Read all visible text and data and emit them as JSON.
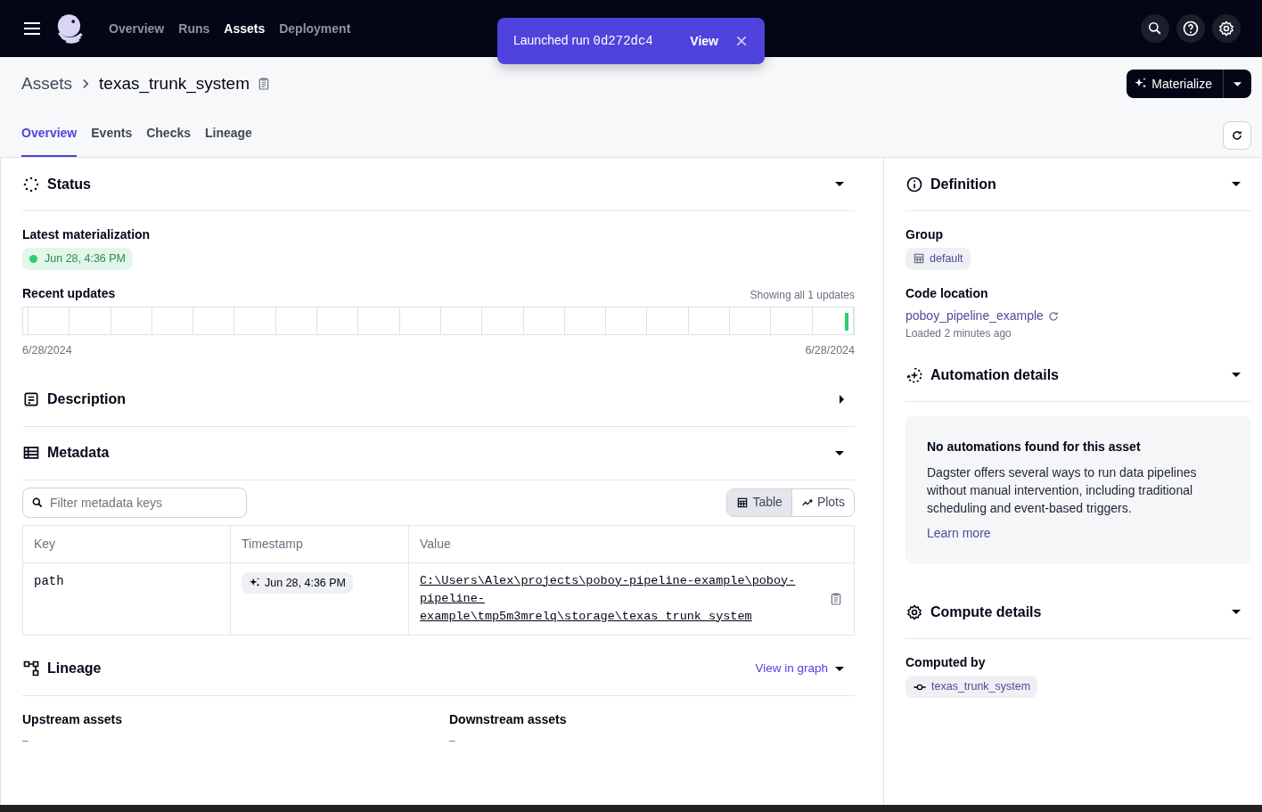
{
  "nav": {
    "items": [
      {
        "label": "Overview",
        "selected": false
      },
      {
        "label": "Runs",
        "selected": false
      },
      {
        "label": "Assets",
        "selected": true
      },
      {
        "label": "Deployment",
        "selected": false
      }
    ]
  },
  "toast": {
    "text": "Launched run",
    "run_id": "0d272dc4",
    "action": "View"
  },
  "breadcrumb": {
    "root": "Assets",
    "current": "texas_trunk_system"
  },
  "materialize_button": "Materialize",
  "tabs": [
    {
      "label": "Overview",
      "selected": true
    },
    {
      "label": "Events",
      "selected": false
    },
    {
      "label": "Checks",
      "selected": false
    },
    {
      "label": "Lineage",
      "selected": false
    }
  ],
  "status": {
    "title": "Status",
    "expanded": true,
    "latest_label": "Latest materialization",
    "latest_tag": {
      "text": "Jun 28, 4:36 PM",
      "color": "#2ecc71"
    },
    "recent_label": "Recent updates",
    "recent_summary": "Showing all 1 updates",
    "start_date": "6/28/2024",
    "end_date": "6/28/2024"
  },
  "description": {
    "title": "Description",
    "expanded": false
  },
  "metadata": {
    "title": "Metadata",
    "expanded": true,
    "filter": {
      "placeholder": "Filter metadata keys"
    },
    "views": [
      {
        "label": "Table",
        "selected": true
      },
      {
        "label": "Plots",
        "selected": false
      }
    ],
    "columns": [
      "Key",
      "Timestamp",
      "Value"
    ],
    "rows": [
      {
        "key": "path",
        "timestamp": "Jun 28, 4:36 PM",
        "value": "C:\\Users\\Alex\\projects\\poboy-pipeline-example\\poboy-pipeline-example\\tmp5m3mrelq\\storage\\texas_trunk_system"
      }
    ]
  },
  "lineage": {
    "title": "Lineage",
    "expanded": true,
    "action": "View in graph",
    "upstream_label": "Upstream assets",
    "upstream_value": "–",
    "downstream_label": "Downstream assets",
    "downstream_value": "–"
  },
  "definition": {
    "title": "Definition",
    "expanded": true,
    "group_label": "Group",
    "group_value": "default",
    "code_location_label": "Code location",
    "code_location": "poboy_pipeline_example",
    "loaded": "Loaded 2 minutes ago"
  },
  "automation": {
    "title": "Automation details",
    "expanded": true,
    "empty_title": "No automations found for this asset",
    "empty_text": "Dagster offers several ways to run data pipelines without manual intervention, including traditional scheduling and event-based triggers.",
    "link": "Learn more"
  },
  "compute": {
    "title": "Compute details",
    "expanded": true,
    "computed_by_label": "Computed by",
    "computed_by": "texas_trunk_system"
  }
}
